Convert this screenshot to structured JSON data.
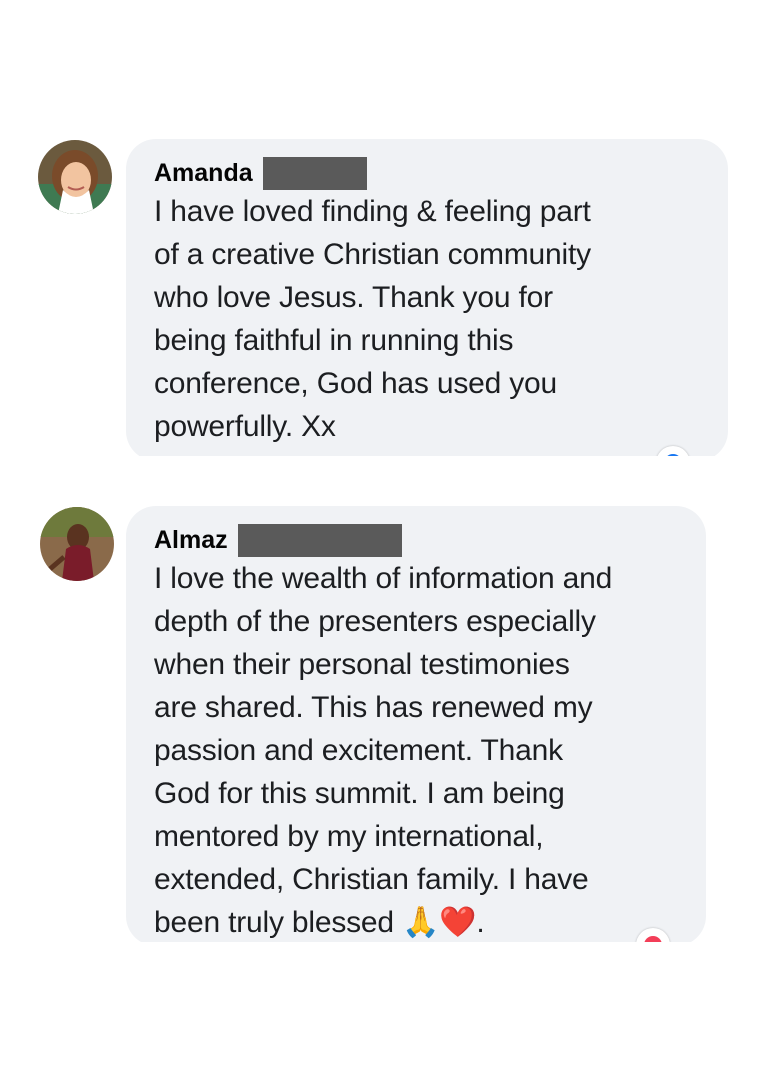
{
  "comments": [
    {
      "author": "Amanda",
      "text": "I have loved finding & feeling part\nof a creative Christian community\nwho love Jesus. Thank you for\nbeing faithful in running this\nconference, God has used you\npowerfully. Xx",
      "reaction_icon": "like-icon",
      "reaction_color": "#1877f2"
    },
    {
      "author": "Almaz",
      "text": "I love the wealth of information and\ndepth of the presenters especially\nwhen their personal testimonies\nare shared. This has renewed my\npassion and excitement. Thank\nGod for this summit. I am being\nmentored by my international,\nextended, Christian family. I have\nbeen truly blessed 🙏❤️.",
      "reaction_icon": "love-icon",
      "reaction_color": "#f33e58"
    }
  ]
}
